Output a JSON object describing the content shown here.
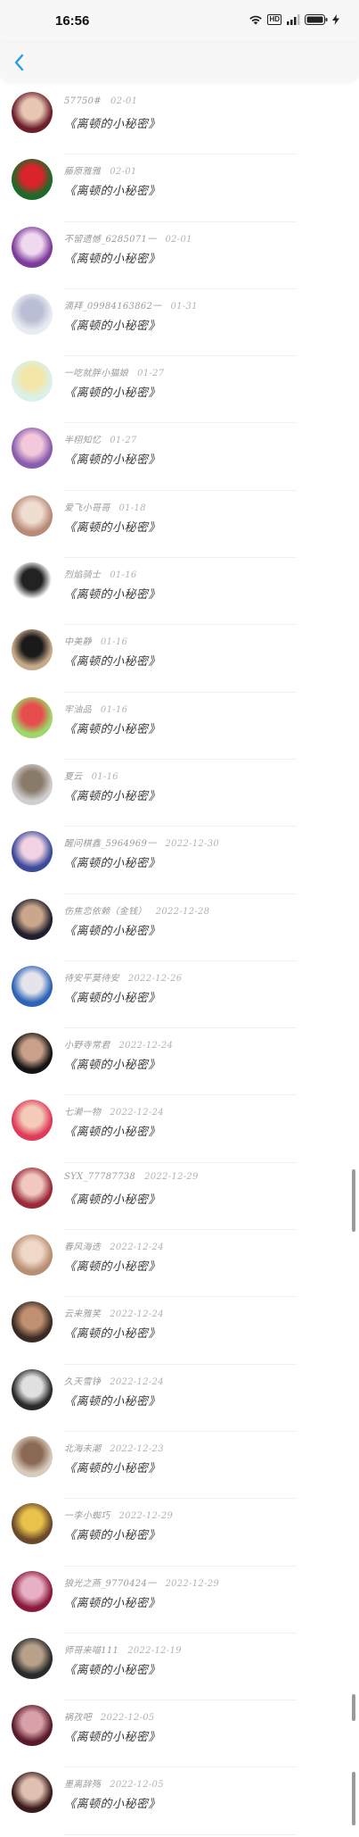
{
  "status_bar": {
    "time": "16:56",
    "hd_label": "HD",
    "signal_label": "5G"
  },
  "list": [
    {
      "name": "57750#",
      "date": "02-01",
      "message": "《离顿的小秘密》",
      "avatar_colors": [
        "#6b1f2a",
        "#e8c6b4"
      ]
    },
    {
      "name": "藤原雅雅",
      "date": "02-01",
      "message": "《离顿的小秘密》",
      "avatar_colors": [
        "#1b6b2a",
        "#d8242a"
      ]
    },
    {
      "name": "不留遗憾_6285071一",
      "date": "02-01",
      "message": "《离顿的小秘密》",
      "avatar_colors": [
        "#7d3c9b",
        "#f0d8ef"
      ]
    },
    {
      "name": "滴拜_09984163862一",
      "date": "01-31",
      "message": "《离顿的小秘密》",
      "avatar_colors": [
        "#e9ebf2",
        "#b9bed4"
      ]
    },
    {
      "name": "一吃就胖小猫娘",
      "date": "01-27",
      "message": "《离顿的小秘密》",
      "avatar_colors": [
        "#d9f1e8",
        "#f3e6a8"
      ]
    },
    {
      "name": "半栩知忆",
      "date": "01-27",
      "message": "《离顿的小秘密》",
      "avatar_colors": [
        "#8a5cae",
        "#f2c8da"
      ]
    },
    {
      "name": "爱飞小哥哥",
      "date": "01-18",
      "message": "《离顿的小秘密》",
      "avatar_colors": [
        "#b88a78",
        "#f0ddd2"
      ]
    },
    {
      "name": "烈焰骑士",
      "date": "01-16",
      "message": "《离顿的小秘密》",
      "avatar_colors": [
        "#ffffff",
        "#222222"
      ]
    },
    {
      "name": "中美静",
      "date": "01-16",
      "message": "《离顿的小秘密》",
      "avatar_colors": [
        "#c8a98a",
        "#1a1a1a"
      ]
    },
    {
      "name": "牢油品",
      "date": "01-16",
      "message": "《离顿的小秘密》",
      "avatar_colors": [
        "#9ed86a",
        "#e64d4d"
      ]
    },
    {
      "name": "夏云",
      "date": "01-16",
      "message": "《离顿的小秘密》",
      "avatar_colors": [
        "#cfcfcf",
        "#8a7a6a"
      ]
    },
    {
      "name": "醒问棋鑫_5964969一",
      "date": "2022-12-30",
      "message": "《离顿的小秘密》",
      "avatar_colors": [
        "#3b4a9a",
        "#f1d2e4"
      ]
    },
    {
      "name": "伤焦恋依赖（金钱）",
      "date": "2022-12-28",
      "message": "《离顿的小秘密》",
      "avatar_colors": [
        "#1f1f2e",
        "#caa68a"
      ]
    },
    {
      "name": "待安平莫待安",
      "date": "2022-12-26",
      "message": "《离顿的小秘密》",
      "avatar_colors": [
        "#2d63b8",
        "#e4e4ea"
      ]
    },
    {
      "name": "小野寺常君",
      "date": "2022-12-24",
      "message": "《离顿的小秘密》",
      "avatar_colors": [
        "#141414",
        "#caa08a"
      ]
    },
    {
      "name": "七濑一物",
      "date": "2022-12-24",
      "message": "《离顿的小秘密》",
      "avatar_colors": [
        "#e03a5a",
        "#f3cbb8"
      ]
    },
    {
      "name": "SYX_77787738",
      "date": "2022-12-29",
      "message": "《离顿的小秘密》",
      "avatar_colors": [
        "#9a2a3a",
        "#f0c8c0"
      ]
    },
    {
      "name": "春风海迭",
      "date": "2022-12-24",
      "message": "《离顿的小秘密》",
      "avatar_colors": [
        "#b98f74",
        "#efd8c8"
      ]
    },
    {
      "name": "云来雅笑",
      "date": "2022-12-24",
      "message": "《离顿的小秘密》",
      "avatar_colors": [
        "#3a2a24",
        "#c09070"
      ]
    },
    {
      "name": "久天雪铮",
      "date": "2022-12-24",
      "message": "《离顿的小秘密》",
      "avatar_colors": [
        "#2a2a2a",
        "#e0e0e0"
      ]
    },
    {
      "name": "北海未潮",
      "date": "2022-12-23",
      "message": "《离顿的小秘密》",
      "avatar_colors": [
        "#d8cabd",
        "#8a6a54"
      ]
    },
    {
      "name": "一李小蜘巧",
      "date": "2022-12-29",
      "message": "《离顿的小秘密》",
      "avatar_colors": [
        "#6a4a2a",
        "#e8c24a"
      ]
    },
    {
      "name": "狼光之燕_9770424一",
      "date": "2022-12-29",
      "message": "《离顿的小秘密》",
      "avatar_colors": [
        "#8a1a3a",
        "#e8b0c4"
      ]
    },
    {
      "name": "师哥来喵111",
      "date": "2022-12-19",
      "message": "《离顿的小秘密》",
      "avatar_colors": [
        "#2a2a2a",
        "#b8a08a"
      ]
    },
    {
      "name": "祸孜吧",
      "date": "2022-12-05",
      "message": "《离顿的小秘密》",
      "avatar_colors": [
        "#5a1a2a",
        "#d8a0a8"
      ]
    },
    {
      "name": "墨离辞殇",
      "date": "2022-12-05",
      "message": "《离顿的小秘密》",
      "avatar_colors": [
        "#3a1a1a",
        "#e0c0b0"
      ]
    }
  ],
  "colors": {
    "accent": "#2b9ae6",
    "name_text": "#9a9a9a",
    "message_text": "#3a3a3a"
  }
}
